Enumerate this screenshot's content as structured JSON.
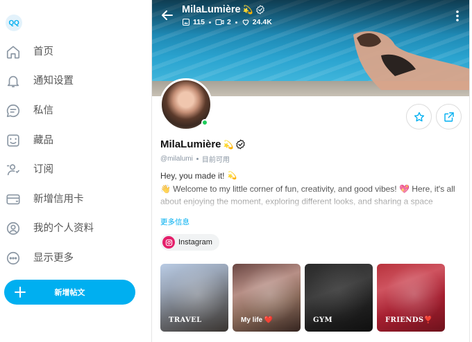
{
  "logo": {
    "text": "QQ"
  },
  "sidebar": {
    "items": [
      {
        "label": "首页",
        "icon": "home-icon"
      },
      {
        "label": "通知设置",
        "icon": "bell-icon"
      },
      {
        "label": "私信",
        "icon": "message-icon"
      },
      {
        "label": "藏品",
        "icon": "collections-icon"
      },
      {
        "label": "订阅",
        "icon": "subscriptions-icon"
      },
      {
        "label": "新增信用卡",
        "icon": "credit-card-icon"
      },
      {
        "label": "我的个人资料",
        "icon": "profile-icon"
      },
      {
        "label": "显示更多",
        "icon": "more-icon"
      }
    ],
    "new_post_label": "新增帖文"
  },
  "profile": {
    "name": "MilaLumière",
    "name_emoji": "💫",
    "stats": {
      "media": "115",
      "videos": "2",
      "likes": "24.4K"
    },
    "handle": "@milalumi",
    "status": "目前可用",
    "bio_line1": "Hey, you made it!",
    "bio_line1_emoji": "💫",
    "bio_line2": "👋 Welcome to my little corner of fun, creativity, and good vibes! 💖 Here, it's all about enjoying the moment, exploring different looks, and sharing a space",
    "more_info": "更多信息",
    "social": {
      "label": "Instagram"
    },
    "colors": {
      "accent": "#00aff0",
      "online": "#1fcc5b",
      "instagram": "#e4206b"
    }
  },
  "highlights": [
    {
      "label": "TRAVEL"
    },
    {
      "label": "My life ❤️"
    },
    {
      "label": "GYM"
    },
    {
      "label": "FRIENDS❣️"
    }
  ]
}
